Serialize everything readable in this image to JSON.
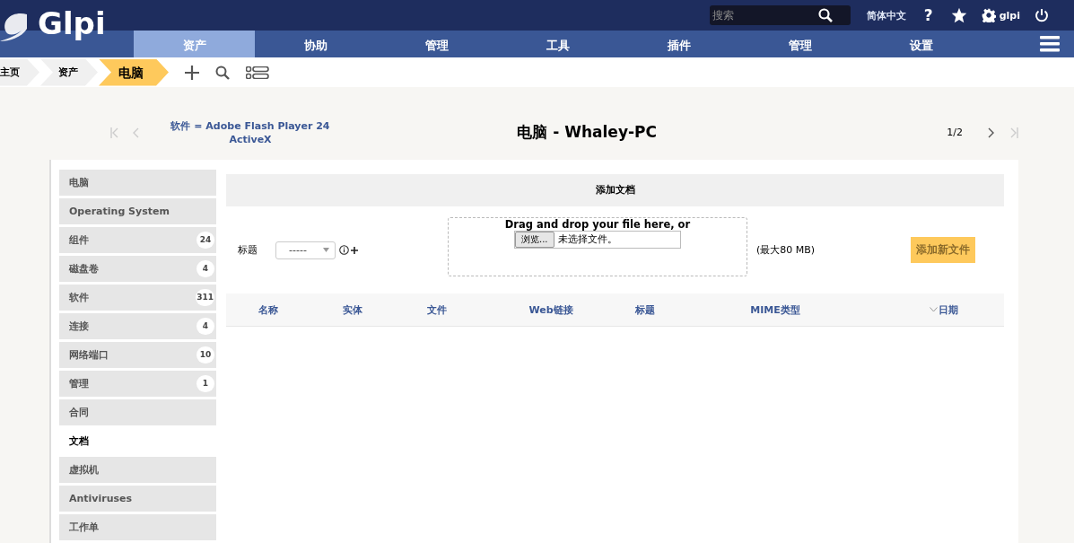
{
  "header": {
    "logo": "Glpi",
    "search": {
      "placeholder": "搜索"
    },
    "language": "简体中文",
    "help": "?",
    "user": "glpi"
  },
  "menu": [
    {
      "label": "资产",
      "selected": true
    },
    {
      "label": "协助",
      "selected": false
    },
    {
      "label": "管理",
      "selected": false
    },
    {
      "label": "工具",
      "selected": false
    },
    {
      "label": "插件",
      "selected": false
    },
    {
      "label": "管理",
      "selected": false
    },
    {
      "label": "设置",
      "selected": false
    }
  ],
  "breadcrumbs": [
    {
      "label": "主页",
      "selected": false
    },
    {
      "label": "资产",
      "selected": false
    },
    {
      "label": "电脑",
      "selected": true
    }
  ],
  "navigation": {
    "link": "软件 = Adobe Flash Player 24 ActiveX",
    "title": "电脑 - Whaley-PC",
    "position": "1/2",
    "first_disabled": true,
    "next_disabled": false
  },
  "sidebar": {
    "items": [
      {
        "label": "电脑",
        "selected": false
      },
      {
        "label": "Operating System",
        "selected": false
      },
      {
        "label": "组件",
        "count": "24",
        "selected": false
      },
      {
        "label": "磁盘卷",
        "count": "4",
        "selected": false
      },
      {
        "label": "软件",
        "count": "311",
        "selected": false
      },
      {
        "label": "连接",
        "count": "4",
        "selected": false
      },
      {
        "label": "网络端口",
        "count": "10",
        "selected": false
      },
      {
        "label": "管理",
        "count": "1",
        "selected": false
      },
      {
        "label": "合同",
        "selected": false
      },
      {
        "label": "文档",
        "selected": true
      },
      {
        "label": "虚拟机",
        "selected": false
      },
      {
        "label": "Antiviruses",
        "selected": false
      },
      {
        "label": "工作单",
        "selected": false
      }
    ]
  },
  "form": {
    "title": "添加文档",
    "field_label": "标题",
    "select_value": "-----",
    "dropzone_text": "Drag and drop your file here, or",
    "browse_button": "浏览...",
    "file_status": "未选择文件。",
    "max_size": "(最大80 MB)",
    "submit_button": "添加新文件"
  },
  "table": {
    "columns": [
      {
        "label": "名称",
        "sorted": false
      },
      {
        "label": "实体",
        "sorted": false
      },
      {
        "label": "文件",
        "sorted": false
      },
      {
        "label": "Web链接",
        "sorted": false
      },
      {
        "label": "标题",
        "sorted": false
      },
      {
        "label": "MIME类型",
        "sorted": false
      },
      {
        "label": "日期",
        "sorted": true
      }
    ]
  }
}
